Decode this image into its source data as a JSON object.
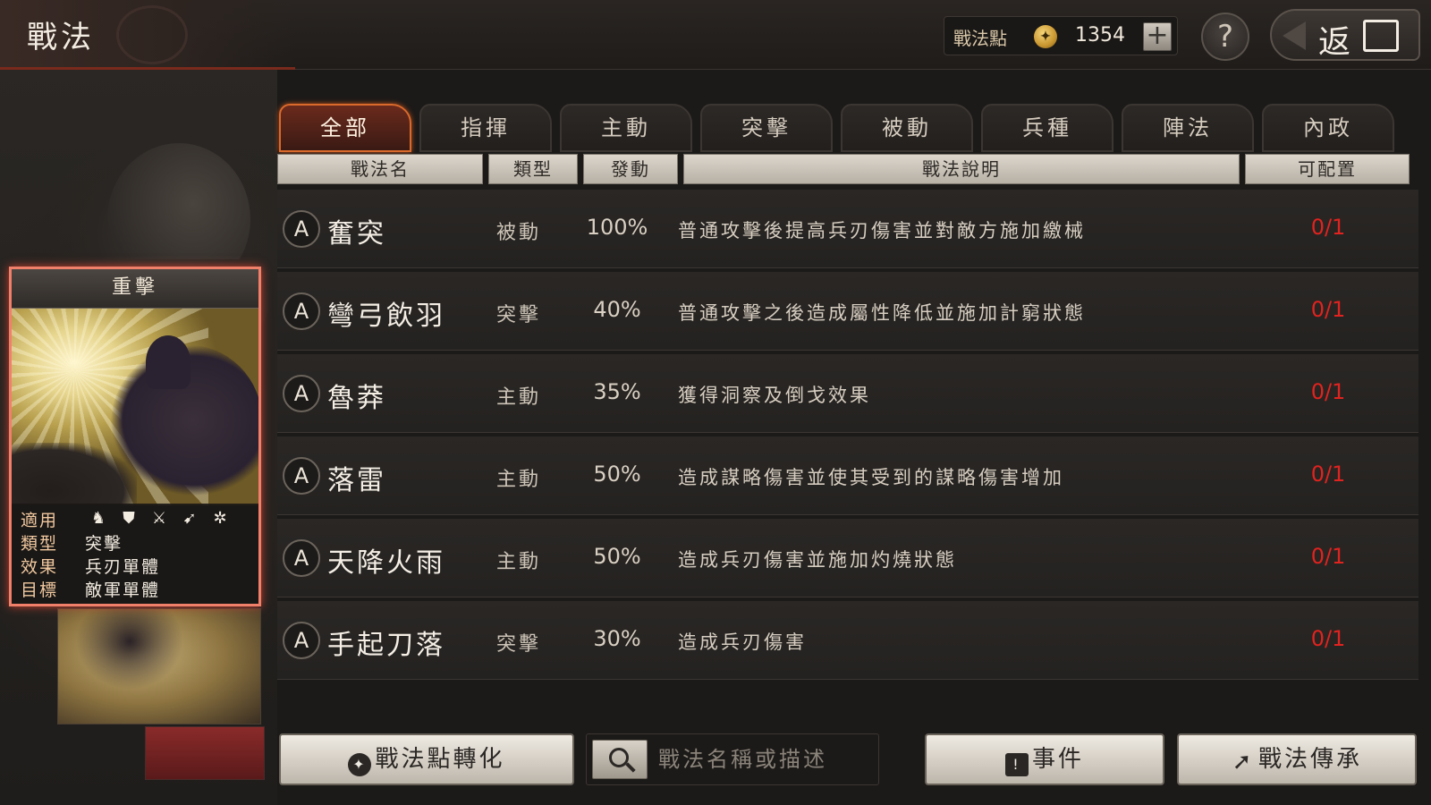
{
  "header": {
    "title": "戰法",
    "points_label": "戰法點",
    "points_value": "1354",
    "add_symbol": "+",
    "help_symbol": "?",
    "back_label": "返",
    "back_box": "回"
  },
  "tabs": [
    {
      "label": "全部",
      "active": true
    },
    {
      "label": "指揮",
      "active": false
    },
    {
      "label": "主動",
      "active": false
    },
    {
      "label": "突擊",
      "active": false
    },
    {
      "label": "被動",
      "active": false
    },
    {
      "label": "兵種",
      "active": false
    },
    {
      "label": "陣法",
      "active": false
    },
    {
      "label": "內政",
      "active": false
    }
  ],
  "columns": {
    "name": "戰法名",
    "type": "類型",
    "rate": "發動",
    "desc": "戰法說明",
    "alloc": "可配置"
  },
  "rows": [
    {
      "grade": "A",
      "name": "奮突",
      "type": "被動",
      "rate": "100%",
      "desc": "普通攻擊後提高兵刃傷害並對敵方施加繳械",
      "alloc": "0/1"
    },
    {
      "grade": "A",
      "name": "彎弓飲羽",
      "type": "突擊",
      "rate": "40%",
      "desc": "普通攻擊之後造成屬性降低並施加計窮狀態",
      "alloc": "0/1"
    },
    {
      "grade": "A",
      "name": "魯莽",
      "type": "主動",
      "rate": "35%",
      "desc": "獲得洞察及倒戈效果",
      "alloc": "0/1"
    },
    {
      "grade": "A",
      "name": "落雷",
      "type": "主動",
      "rate": "50%",
      "desc": "造成謀略傷害並使其受到的謀略傷害增加",
      "alloc": "0/1"
    },
    {
      "grade": "A",
      "name": "天降火雨",
      "type": "主動",
      "rate": "50%",
      "desc": "造成兵刃傷害並施加灼燒狀態",
      "alloc": "0/1"
    },
    {
      "grade": "A",
      "name": "手起刀落",
      "type": "突擊",
      "rate": "30%",
      "desc": "造成兵刃傷害",
      "alloc": "0/1"
    }
  ],
  "card": {
    "title": "重擊",
    "applicable_label": "適用",
    "unit_icons": [
      "cavalry-icon",
      "shield-icon",
      "crossed-swords-icon",
      "spear-icon",
      "wheel-icon"
    ],
    "type_label": "類型",
    "type_value": "突擊",
    "effect_label": "效果",
    "effect_value": "兵刃單體",
    "target_label": "目標",
    "target_value": "敵軍單體"
  },
  "footer": {
    "convert_label": "戰法點轉化",
    "search_placeholder": "戰法名稱或描述",
    "event_label": "事件",
    "inherit_label": "戰法傳承"
  },
  "colors": {
    "accent": "#d96a2c",
    "alloc_red": "#e0231f",
    "card_border": "#f0806a"
  }
}
